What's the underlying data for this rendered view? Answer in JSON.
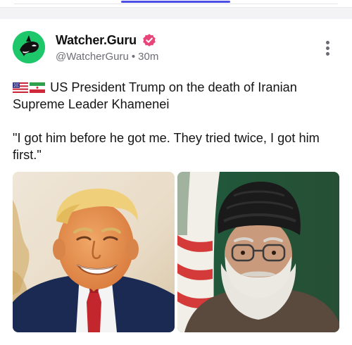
{
  "post": {
    "author_name": "Watcher.Guru",
    "handle": "@WatcherGuru",
    "separator": "•",
    "time": "30m",
    "flags": [
      "🇺🇸",
      "🇮🇷"
    ],
    "line1": "US President Trump on the death of Iranian Supreme Leader Khamenei",
    "line2": "\"I got him before he got me. They tried twice, I got him first.\"",
    "icons": {
      "avatar": "orca-logo-icon",
      "verified": "verified-badge-icon",
      "more": "more-options-icon"
    },
    "colors": {
      "avatar_bg": "#1ec76a",
      "verified_badge": "#e8467a",
      "tab_accent": "#4d4ee6"
    }
  }
}
